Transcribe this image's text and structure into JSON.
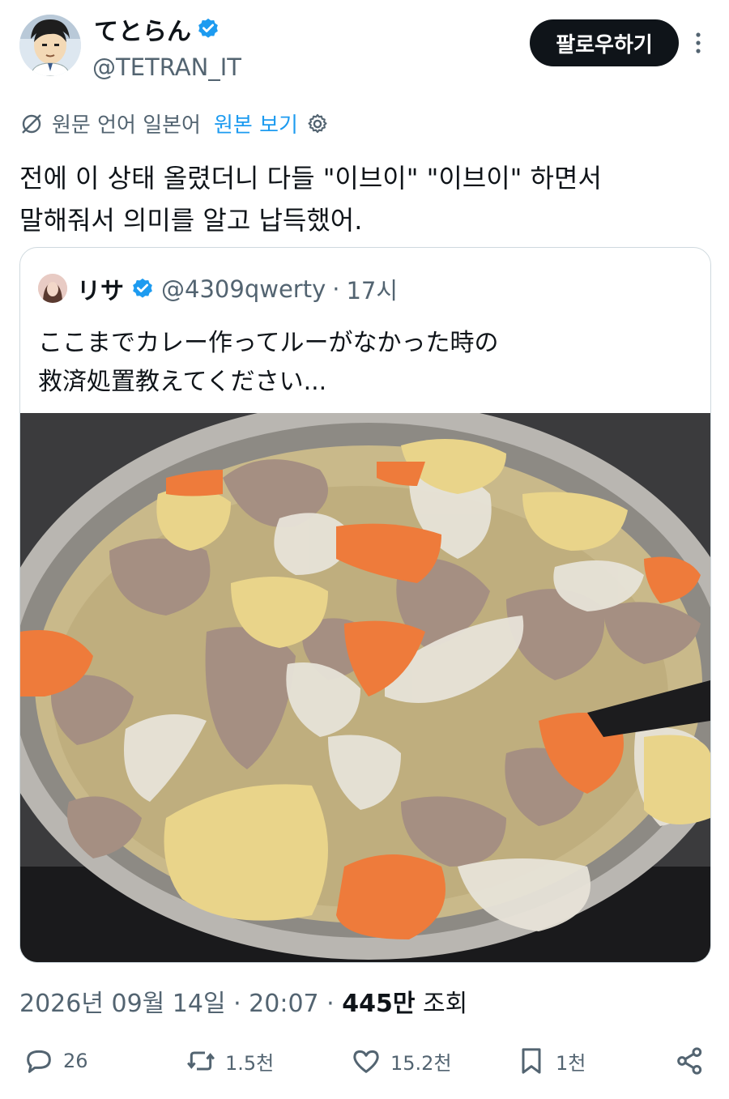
{
  "author": {
    "display_name": "てとらん",
    "handle": "@TETRAN_IT",
    "follow_label": "팔로우하기"
  },
  "translation": {
    "info": "원문 언어 일본어",
    "show_original": "원본 보기"
  },
  "tweet": {
    "lines": [
      "전에 이 상태 올렸더니 다들 \"이브이\" \"이브이\" 하면서",
      "말해줘서 의미를 알고 납득했어."
    ],
    "date": "2026년 09월 14일 · 20:07 ·",
    "views_count": "445만",
    "views_label": "조회"
  },
  "quoted": {
    "name": "リサ",
    "handle": "@4309qwerty",
    "separator": "·",
    "time": "17시",
    "lines": [
      "ここまでカレー作ってルーがなかった時の",
      "救済処置教えてください..."
    ]
  },
  "actions": {
    "replies": "26",
    "reposts": "1.5천",
    "likes": "15.2천",
    "bookmarks": "1천"
  },
  "colors": {
    "accent": "#1d9bf0",
    "muted": "#536471",
    "text": "#0f1419"
  }
}
